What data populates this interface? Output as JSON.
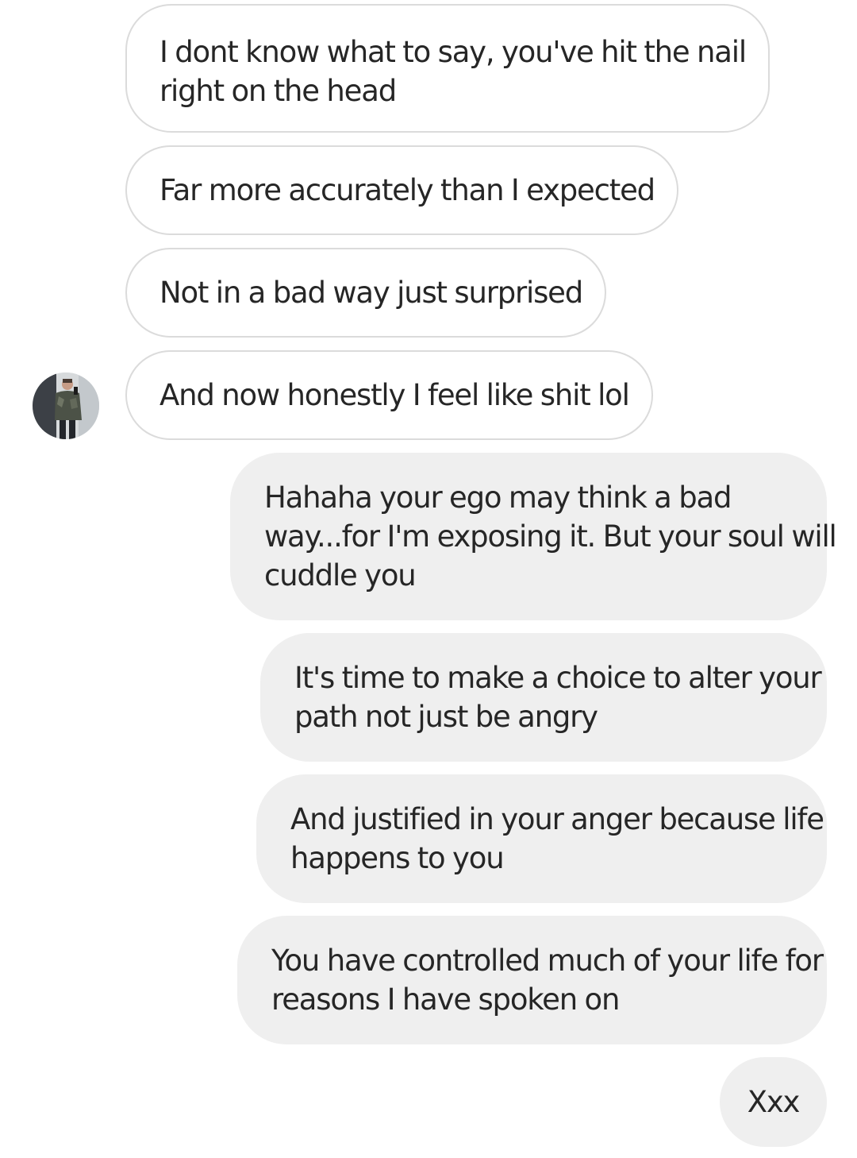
{
  "thread": {
    "incoming": [
      {
        "lines": [
          "I dont know what to say, you've hit the nail",
          "right on the head"
        ]
      },
      {
        "lines": [
          "Far more accurately than I expected"
        ]
      },
      {
        "lines": [
          "Not in a bad way just surprised"
        ]
      },
      {
        "lines": [
          "And now honestly I feel like shit lol"
        ]
      }
    ],
    "outgoing": [
      {
        "lines": [
          "Hahaha your ego may think a bad",
          "way...for I'm exposing it. But your soul will",
          "cuddle you"
        ]
      },
      {
        "lines": [
          "It's time to make a choice to alter your",
          "path not just be angry"
        ]
      },
      {
        "lines": [
          "And justified in your anger because life",
          "happens to you"
        ]
      },
      {
        "lines": [
          "You have controlled much of your life for",
          "reasons I have spoken on"
        ]
      },
      {
        "lines": [
          "Xxx"
        ]
      }
    ]
  },
  "avatar": {
    "icon": "user-avatar-photo"
  },
  "colors": {
    "incoming_bg": "#ffffff",
    "incoming_border": "#dbdbdb",
    "outgoing_bg": "#efefef",
    "text": "#262626"
  }
}
